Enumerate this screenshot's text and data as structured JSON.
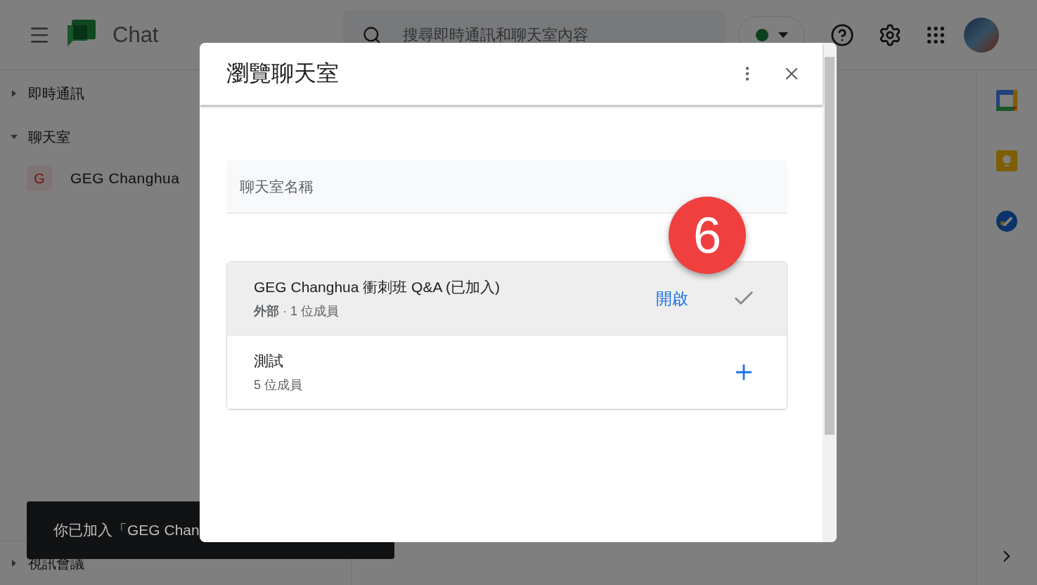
{
  "app": {
    "title": "Chat",
    "search": {
      "placeholder": "搜尋即時通訊和聊天室內容"
    },
    "sections": [
      {
        "label": "即時通訊",
        "expanded": false
      },
      {
        "label": "聊天室",
        "expanded": true,
        "items": [
          {
            "initial": "G",
            "name": "GEG Changhua"
          }
        ]
      },
      {
        "label": "視訊會議",
        "expanded": false
      }
    ]
  },
  "snackbar": {
    "text": "你已加入「GEG Chan"
  },
  "dialog": {
    "title": "瀏覽聊天室",
    "search": {
      "placeholder": "聊天室名稱"
    },
    "rooms": [
      {
        "name": "GEG Changhua 衝刺班 Q&A (已加入)",
        "meta": "**外部** · 1 位成員",
        "joined": true,
        "selected": true,
        "action": "開啟"
      },
      {
        "name": "測試",
        "meta": "5 位成員",
        "joined": false,
        "selected": false
      }
    ]
  },
  "annotation": {
    "step": "6"
  }
}
